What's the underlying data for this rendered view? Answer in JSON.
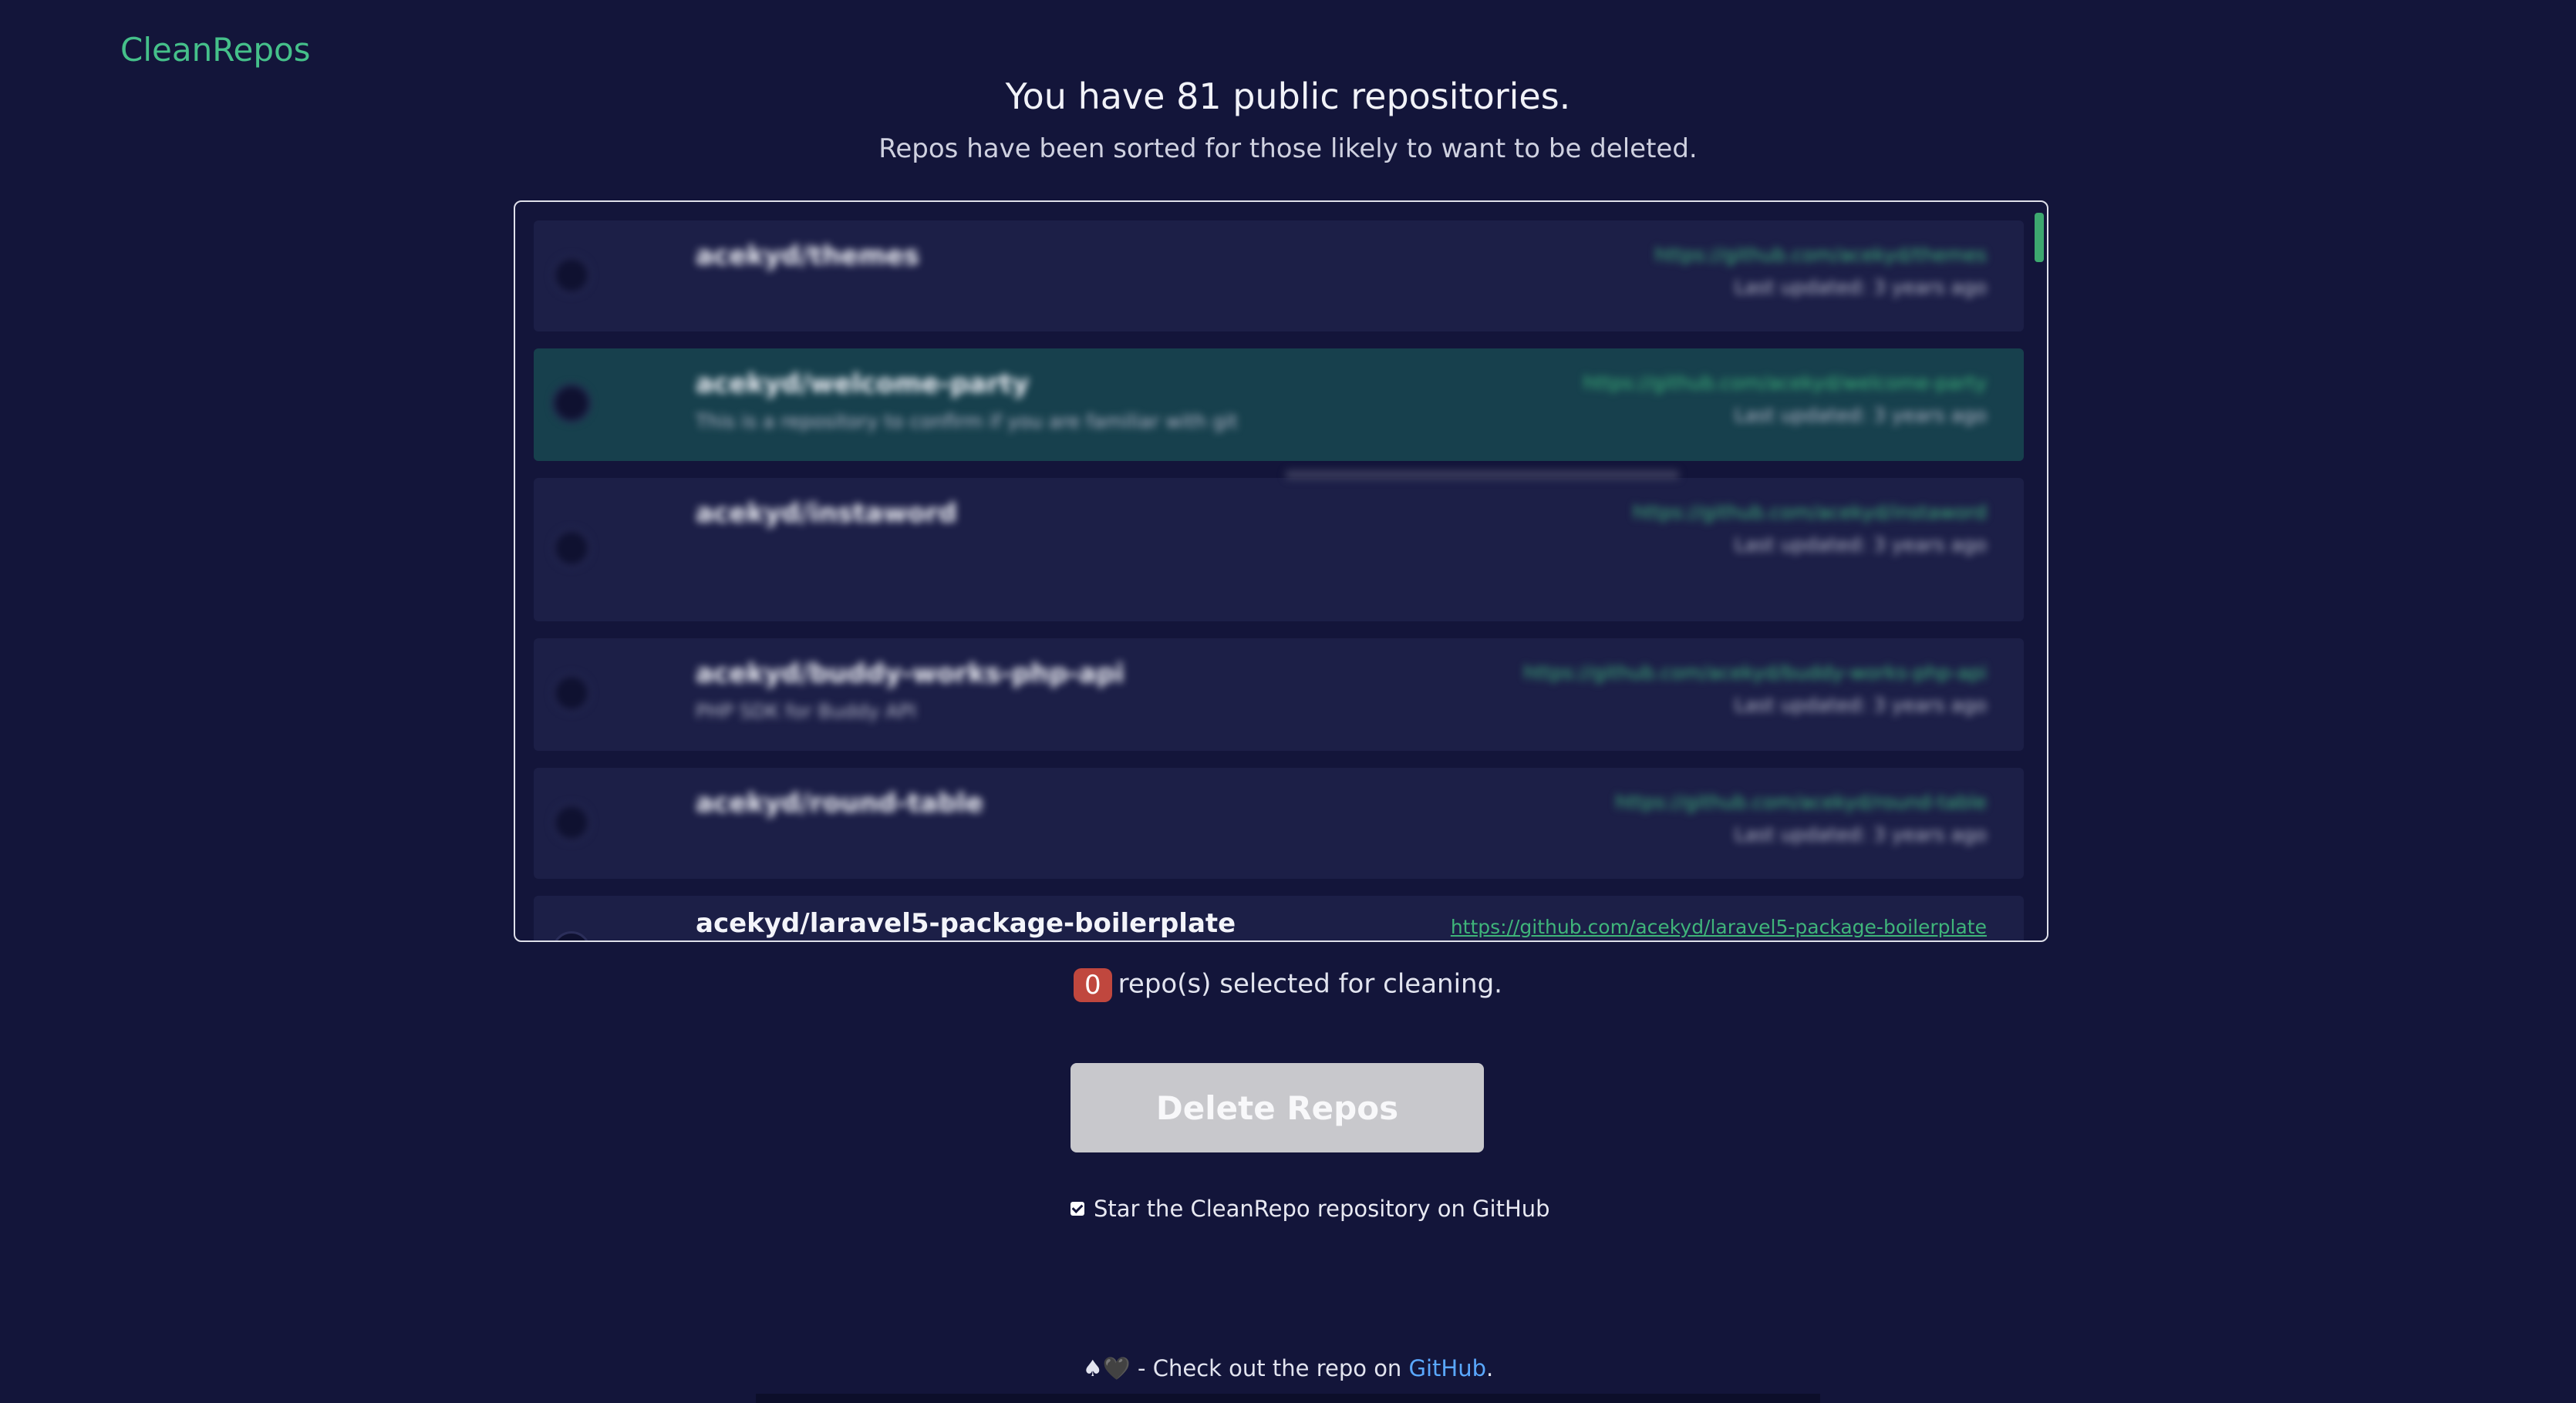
{
  "brand": {
    "logo": "CleanRepos"
  },
  "header": {
    "title": "You have 81 public repositories.",
    "subtitle": "Repos have been sorted for those likely to want to be deleted."
  },
  "repos": [
    {
      "name": "acekyd/themes",
      "description": "",
      "url": "https://github.com/acekyd/themes",
      "updated": "Last updated: 3 years ago"
    },
    {
      "name": "acekyd/welcome-party",
      "description": "This is a repository to confirm if you are familiar with git",
      "url": "https://github.com/acekyd/welcome-party",
      "updated": "Last updated: 3 years ago"
    },
    {
      "name": "acekyd/instaword",
      "description": "",
      "description2": "",
      "url": "https://github.com/acekyd/instaword",
      "updated": "Last updated: 3 years ago",
      "tooltip": ""
    },
    {
      "name": "acekyd/buddy-works-php-api",
      "description": "PHP SDK for Buddy API",
      "url": "https://github.com/acekyd/buddy-works-php-api",
      "updated": "Last updated: 3 years ago"
    },
    {
      "name": "acekyd/round-table",
      "description": "",
      "url": "https://github.com/acekyd/round-table",
      "updated": "Last updated: 3 years ago"
    },
    {
      "name": "acekyd/laravel5-package-boilerplate",
      "description": "",
      "url": "https://github.com/acekyd/laravel5-package-boilerplate",
      "updated": ""
    }
  ],
  "selection": {
    "count": "0",
    "suffix": "repo(s) selected for cleaning."
  },
  "actions": {
    "delete_label": "Delete Repos",
    "star_label": "Star the CleanRepo repository on GitHub",
    "star_checked": true
  },
  "footer": {
    "prefix": "♠🖤  - Check out the repo on ",
    "link_text": "GitHub",
    "suffix": "."
  },
  "colors": {
    "background": "#13153a",
    "accent": "#45c08a",
    "badge": "#c0473e"
  }
}
